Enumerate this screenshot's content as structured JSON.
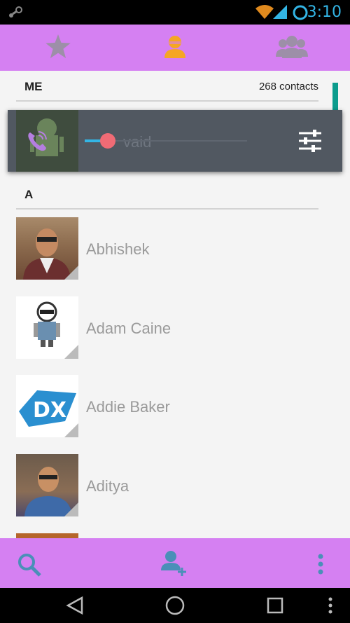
{
  "status": {
    "time": "3:10"
  },
  "tabs": [
    {
      "name": "favorites",
      "icon": "star-icon"
    },
    {
      "name": "contacts",
      "icon": "person-icon",
      "active": true
    },
    {
      "name": "groups",
      "icon": "group-icon"
    }
  ],
  "me_section": {
    "label": "ME",
    "count": "268 contacts"
  },
  "me_contact": {
    "name": "nik vaid",
    "name_visible": "vaid"
  },
  "volume_popup": {
    "slider_level_percent": 15,
    "accent_color": "#f06b75",
    "track_color": "#33b5e5"
  },
  "a_section": {
    "label": "A"
  },
  "contacts": [
    {
      "name": "Abhishek"
    },
    {
      "name": "Adam Caine"
    },
    {
      "name": "Addie Baker"
    },
    {
      "name": "Aditya"
    }
  ],
  "colors": {
    "bar": "#d580f2",
    "active_tab": "#f5a623",
    "inactive_tab": "#9d8fa8",
    "action_icon": "#4a8fb8"
  }
}
